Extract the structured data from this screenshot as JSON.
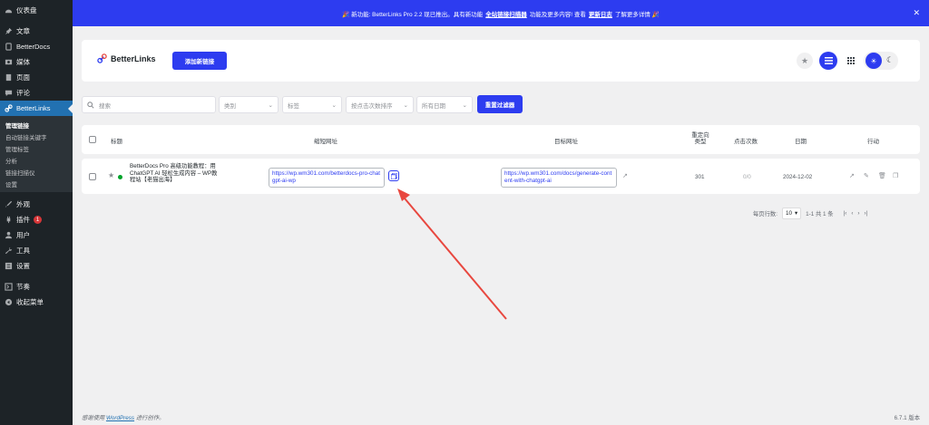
{
  "notice": {
    "prefix": "🎉 新功能: BetterLinks Pro 2.2 现已推出。具有新功能",
    "link1": "全站链接扫描器",
    "middle": "功能及更多内容! 查看",
    "link2": "更新日志",
    "suffix": "了解更多详情 🎉"
  },
  "sidebar": {
    "items": [
      {
        "label": "仪表盘",
        "icon": "dashboard-icon"
      },
      {
        "label": "文章",
        "icon": "pin-icon"
      },
      {
        "label": "BetterDocs",
        "icon": "docs-icon"
      },
      {
        "label": "媒体",
        "icon": "media-icon"
      },
      {
        "label": "页面",
        "icon": "page-icon"
      },
      {
        "label": "评论",
        "icon": "comment-icon"
      },
      {
        "label": "BetterLinks",
        "icon": "betterlinks-icon"
      }
    ],
    "submenu": [
      "管理链接",
      "自动链接关键字",
      "管理标签",
      "分析",
      "链接扫描仪",
      "设置"
    ],
    "items2": [
      {
        "label": "外观",
        "icon": "brush-icon"
      },
      {
        "label": "插件",
        "icon": "plugin-icon",
        "badge": "1"
      },
      {
        "label": "用户",
        "icon": "user-icon"
      },
      {
        "label": "工具",
        "icon": "wrench-icon"
      },
      {
        "label": "设置",
        "icon": "settings-icon"
      },
      {
        "label": "节奏",
        "icon": "rhythm-icon"
      },
      {
        "label": "收起菜单",
        "icon": "collapse-icon"
      }
    ]
  },
  "header": {
    "logo_text": "BetterLinks",
    "add_button": "添加新链接"
  },
  "filters": {
    "search_placeholder": "搜索",
    "category": "类别",
    "tags": "标签",
    "sort": "按点击次数排序",
    "date": "所有日期",
    "reset": "重置过滤器"
  },
  "table": {
    "headers": {
      "title": "标题",
      "short_url": "缩短网址",
      "target_url": "目标网址",
      "redirect_type": "重定向类型",
      "clicks": "点击次数",
      "date": "日期",
      "actions": "行动"
    },
    "row": {
      "title": "BetterDocs Pro 高级功能教程：用 ChatGPT AI 轻松生成内容 – WP教程站【老猫出海】",
      "short_url": "https://wp.wm301.com/betterdocs-pro-chatgpt-ai-wp",
      "target_url": "https://wp.wm301.com/docs/generate-content-with-chatgpt-ai",
      "redirect": "301",
      "clicks": "0/0",
      "date": "2024-12-02"
    }
  },
  "pager": {
    "rows_label": "每页行数:",
    "rows_value": "10",
    "range": "1-1 共 1 条"
  },
  "footer": {
    "left_prefix": "感谢使用",
    "left_link": "WordPress",
    "left_suffix": "进行创作。",
    "version": "6.7.1 版本"
  },
  "colors": {
    "accent": "#2d3cf0",
    "sidebar": "#1d2327",
    "active": "#2271b1",
    "arrow": "#e8473f"
  }
}
